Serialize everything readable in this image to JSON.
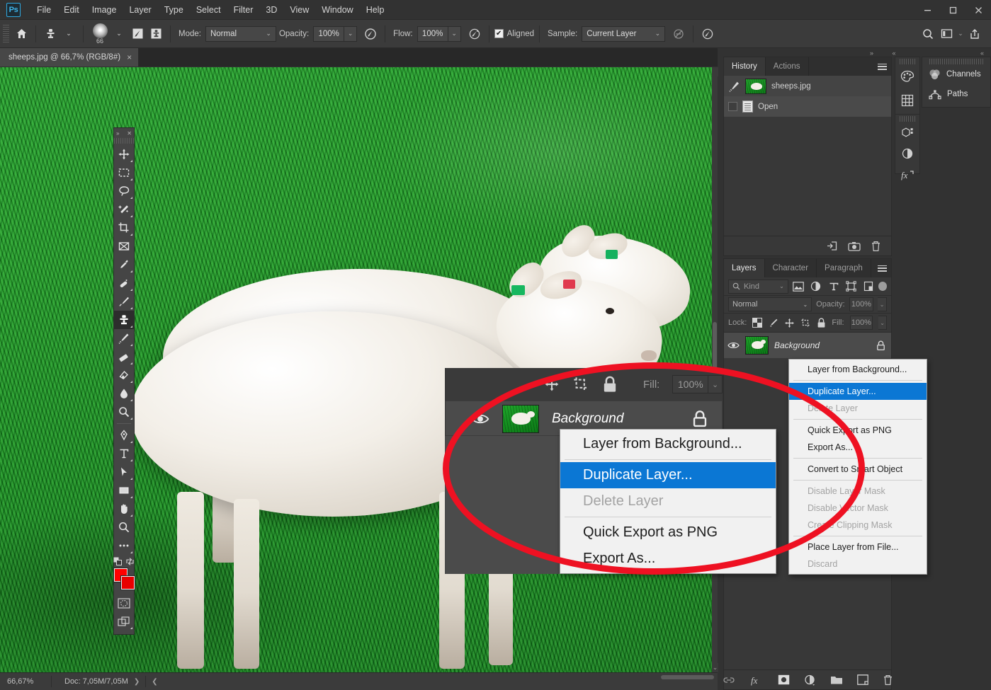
{
  "app": {
    "logo": "Ps",
    "menus": [
      "File",
      "Edit",
      "Image",
      "Layer",
      "Type",
      "Select",
      "Filter",
      "3D",
      "View",
      "Window",
      "Help"
    ],
    "window_controls": [
      "minimize-button",
      "maximize-button",
      "close-button"
    ],
    "accent_blue": "#0b77d4",
    "highlight_red": "#ee1122"
  },
  "options_bar": {
    "home_icon": "home-icon",
    "tool_preset_icon": "clone-stamp-preset-icon",
    "brush_size": "66",
    "toggle_brush_panel_icon": "brush-panel-icon",
    "toggle_clone_source_icon": "clone-source-panel-icon",
    "mode_label": "Mode:",
    "mode_value": "Normal",
    "opacity_label": "Opacity:",
    "opacity_value": "100%",
    "pressure_opacity_icon": "pressure-opacity-icon",
    "flow_label": "Flow:",
    "flow_value": "100%",
    "airbrush_icon": "airbrush-icon",
    "aligned_label": "Aligned",
    "aligned_checked": "✔",
    "sample_label": "Sample:",
    "sample_value": "Current Layer",
    "ignore_adjustment_icon": "ignore-adjustment-layers-icon",
    "pressure_size_icon": "pressure-size-icon",
    "search_icon": "search-icon",
    "workspace_icon": "workspace-switcher-icon",
    "workspace_caret": "⌄",
    "share_icon": "share-icon"
  },
  "document": {
    "tab_title": "sheeps.jpg @ 66,7% (RGB/8#)",
    "tab_close": "×"
  },
  "status_bar": {
    "zoom": "66,67%",
    "doc_info": "Doc: 7,05M/7,05M",
    "expand_arrow": "❯",
    "collapse_arrow": "❮"
  },
  "toolbar": {
    "collapse_icon": "collapse-panel-icon",
    "close_icon": "close-panel-icon",
    "tools": [
      {
        "name": "move-tool",
        "label": "Move Tool"
      },
      {
        "name": "rectangular-marquee-tool",
        "label": "Rectangular Marquee Tool"
      },
      {
        "name": "lasso-tool",
        "label": "Lasso Tool"
      },
      {
        "name": "magic-wand-tool",
        "label": "Object Selection / Magic Wand Tool"
      },
      {
        "name": "crop-tool",
        "label": "Crop Tool"
      },
      {
        "name": "frame-tool",
        "label": "Frame Tool"
      },
      {
        "name": "eyedropper-tool",
        "label": "Eyedropper Tool"
      },
      {
        "name": "healing-brush-tool",
        "label": "Spot Healing Brush Tool"
      },
      {
        "name": "brush-tool",
        "label": "Brush Tool"
      },
      {
        "name": "clone-stamp-tool",
        "label": "Clone Stamp Tool",
        "active": true
      },
      {
        "name": "history-brush-tool",
        "label": "History Brush Tool"
      },
      {
        "name": "eraser-tool",
        "label": "Eraser Tool"
      },
      {
        "name": "gradient-tool",
        "label": "Gradient Tool"
      },
      {
        "name": "blur-tool",
        "label": "Blur Tool"
      },
      {
        "name": "dodge-tool",
        "label": "Dodge Tool"
      },
      {
        "name": "pen-tool",
        "label": "Pen Tool"
      },
      {
        "name": "type-tool",
        "label": "Horizontal Type Tool"
      },
      {
        "name": "path-selection-tool",
        "label": "Path Selection Tool"
      },
      {
        "name": "rectangle-tool",
        "label": "Rectangle Tool"
      },
      {
        "name": "hand-tool",
        "label": "Hand Tool"
      },
      {
        "name": "zoom-tool",
        "label": "Zoom Tool"
      },
      {
        "name": "edit-toolbar-tool",
        "label": "Edit Toolbar"
      }
    ],
    "swap_colors_icon": "swap-colors-icon",
    "default_colors_icon": "default-colors-icon",
    "foreground_color": "#ff0000",
    "background_color": "#e80000",
    "quick_mask_icon": "quick-mask-icon",
    "screen_mode_icon": "screen-mode-icon"
  },
  "history_panel": {
    "tabs": [
      {
        "label": "History",
        "active": true
      },
      {
        "label": "Actions",
        "active": false
      }
    ],
    "menu_icon": "panel-menu-icon",
    "rows": [
      {
        "label": "sheeps.jpg",
        "type": "snapshot"
      },
      {
        "label": "Open",
        "type": "state",
        "selected": true
      }
    ],
    "footer_icons": [
      "create-document-from-state-icon",
      "create-snapshot-icon",
      "delete-state-icon"
    ]
  },
  "layers_panel": {
    "tabs": [
      {
        "label": "Layers",
        "active": true
      },
      {
        "label": "Character",
        "active": false
      },
      {
        "label": "Paragraph",
        "active": false
      }
    ],
    "menu_icon": "panel-menu-icon",
    "filter": {
      "search_icon": "search-icon",
      "kind_label": "Kind",
      "caret": "⌄",
      "icons": [
        "filter-pixel-icon",
        "filter-adjustment-icon",
        "filter-type-icon",
        "filter-shape-icon",
        "filter-smart-object-icon"
      ],
      "toggle_name": "filter-toggle-switch"
    },
    "blend_mode": "Normal",
    "opacity_label": "Opacity:",
    "opacity_value": "100%",
    "lock_label": "Lock:",
    "lock_icons": [
      "lock-transparent-pixels-icon",
      "lock-image-pixels-icon",
      "lock-position-icon",
      "lock-artboard-nesting-icon",
      "lock-all-icon"
    ],
    "fill_label": "Fill:",
    "fill_value": "100%",
    "layers": [
      {
        "name": "Background",
        "visible": true,
        "locked": true
      }
    ],
    "footer_icons": [
      "link-layers-icon",
      "layer-style-fx-icon",
      "add-layer-mask-icon",
      "new-adjustment-layer-icon",
      "new-group-icon",
      "new-layer-icon",
      "delete-layer-icon"
    ]
  },
  "icon_rail": {
    "groups": [
      [
        "color-panel-icon",
        "swatches-panel-icon"
      ],
      [
        "libraries-panel-icon",
        "adjustments-panel-icon",
        "styles-fx-panel-icon"
      ]
    ],
    "channels_label": "Channels",
    "channels_icon": "channels-panel-icon",
    "paths_label": "Paths",
    "paths_icon": "paths-panel-icon",
    "collapse_icons": [
      "expand-dock-icon",
      "collapse-dock-icon",
      "collapse-dock-icon"
    ]
  },
  "context_menu": {
    "items": [
      {
        "label": "Layer from Background...",
        "state": "normal"
      },
      {
        "separator": true
      },
      {
        "label": "Duplicate Layer...",
        "state": "highlighted"
      },
      {
        "label": "Delete Layer",
        "state": "disabled"
      },
      {
        "separator": true
      },
      {
        "label": "Quick Export as PNG",
        "state": "normal"
      },
      {
        "label": "Export As...",
        "state": "normal"
      },
      {
        "separator": true
      },
      {
        "label": "Convert to Smart Object",
        "state": "normal"
      },
      {
        "separator": true
      },
      {
        "label": "Disable Layer Mask",
        "state": "disabled"
      },
      {
        "label": "Disable Vector Mask",
        "state": "disabled"
      },
      {
        "label": "Create Clipping Mask",
        "state": "disabled"
      },
      {
        "separator": true
      },
      {
        "label": "Place Layer from File...",
        "state": "normal"
      },
      {
        "label": "Discard",
        "state": "disabled"
      }
    ]
  },
  "callout": {
    "shape": "red-ellipse-highlight",
    "color": "#ee1122",
    "layer_row": {
      "name": "Background",
      "eye_icon": "layer-visibility-eye-icon",
      "lock_icon": "layer-locked-icon",
      "thumbnail": "layer-thumbnail-sheep"
    },
    "lock_bar": {
      "move_icon": "lock-position-icon",
      "artboard_icon": "lock-artboard-nesting-icon",
      "lock_all_icon": "lock-all-icon",
      "fill_label": "Fill:",
      "fill_value": "100%",
      "caret": "⌄"
    },
    "menu_items": [
      {
        "label": "Layer from Background...",
        "state": "normal"
      },
      {
        "separator": true
      },
      {
        "label": "Duplicate Layer...",
        "state": "highlighted"
      },
      {
        "label": "Delete Layer",
        "state": "disabled"
      },
      {
        "separator": true
      },
      {
        "label": "Quick Export as PNG",
        "state": "normal"
      },
      {
        "label": "Export As...",
        "state": "normal"
      }
    ]
  },
  "canvas": {
    "image_description": "Two white lambs standing on bright green grass",
    "scroll_up_arrow": "⌃",
    "scroll_down_arrow": "⌄"
  }
}
